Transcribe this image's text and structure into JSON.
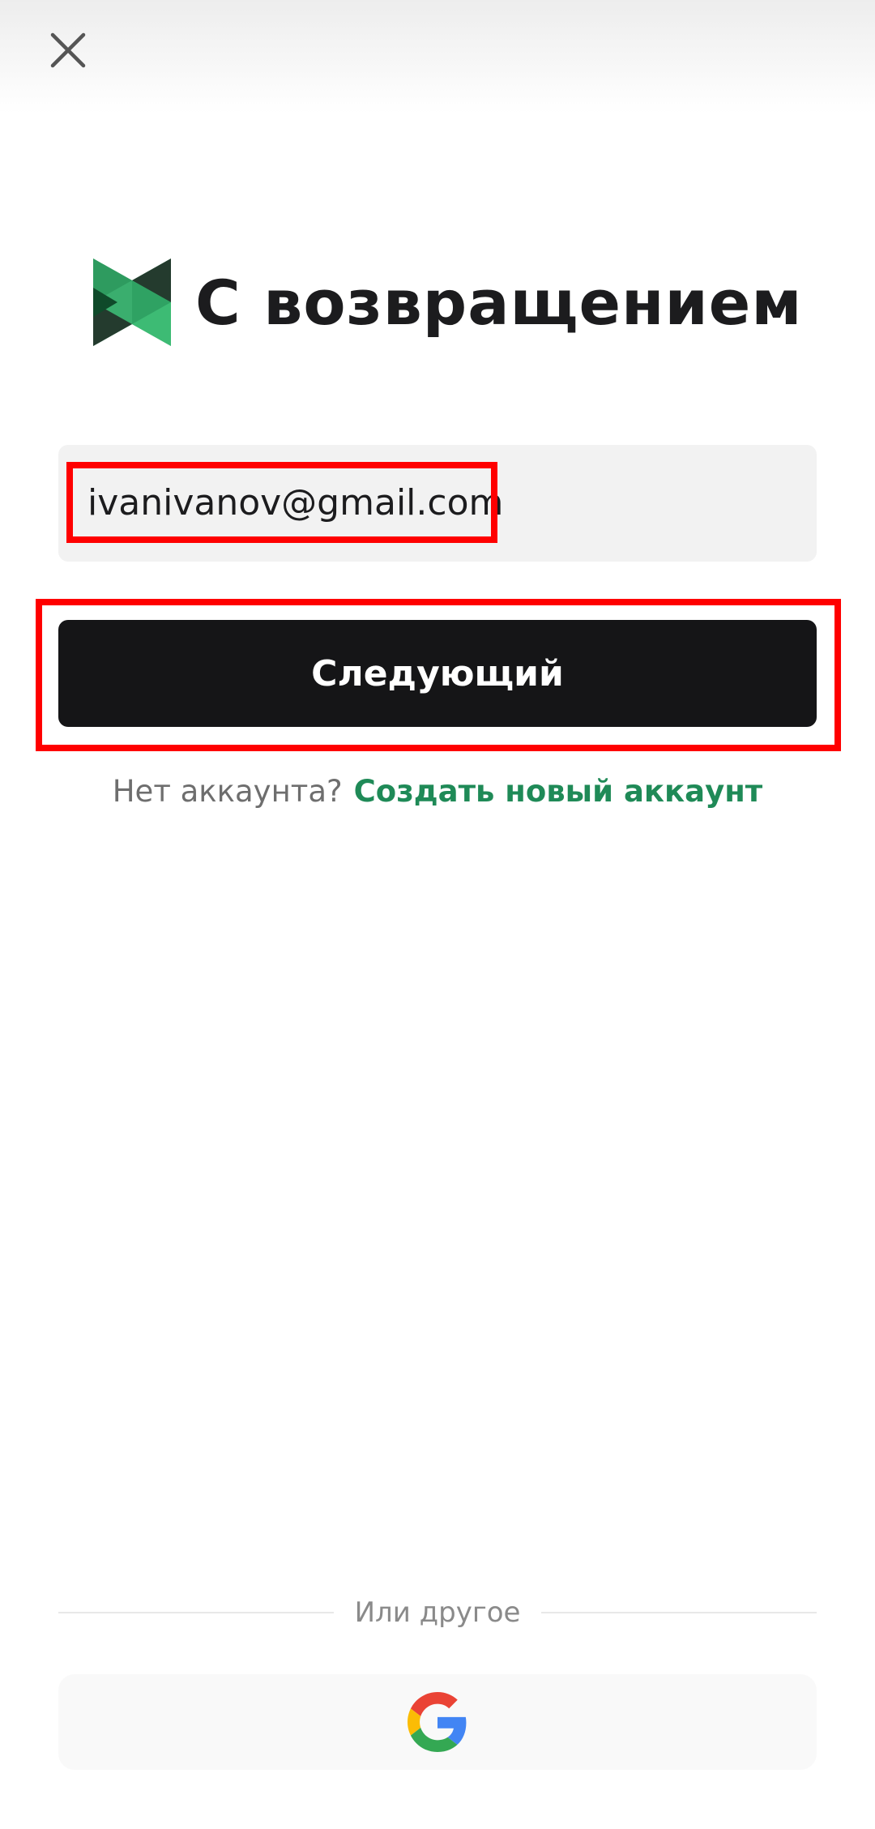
{
  "header": {
    "close_icon": "close-icon"
  },
  "brand": {
    "logo_icon": "brand-logo-icon",
    "title": "С возвращением",
    "logo_colors": [
      "#3aae6e",
      "#1f7a48",
      "#0f4a2a",
      "#243b2e"
    ]
  },
  "form": {
    "email_value": "ivanivanov@gmail.com",
    "next_label": "Следующий"
  },
  "signup": {
    "prompt": "Нет аккаунта?",
    "link_label": "Создать новый аккаунт",
    "link_color": "#1f8a57"
  },
  "alternatives": {
    "divider_label": "Или другое",
    "google_icon": "google-icon"
  },
  "annotations": {
    "highlight_color": "#ff0000"
  }
}
